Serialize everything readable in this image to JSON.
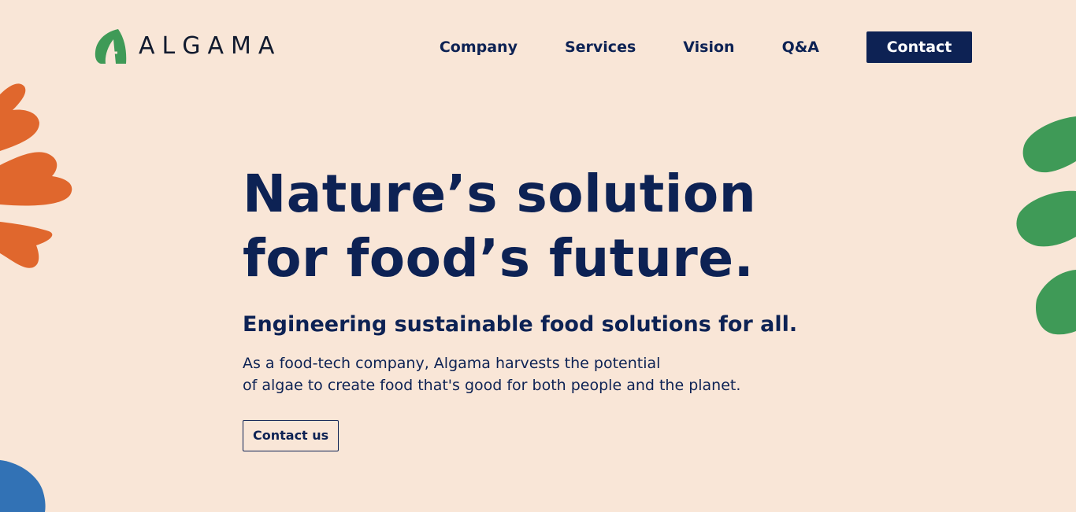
{
  "brand": {
    "name": "ALGAMA",
    "logo_icon": "algae-leaf-a-icon",
    "logo_color": "#3f9a57"
  },
  "nav": {
    "items": [
      {
        "label": "Company"
      },
      {
        "label": "Services"
      },
      {
        "label": "Vision"
      },
      {
        "label": "Q&A"
      }
    ],
    "contact_label": "Contact"
  },
  "hero": {
    "headline_line1": "Nature’s solution",
    "headline_line2": "for food’s future.",
    "subheadline": "Engineering sustainable food solutions for all.",
    "description_line1": "As a food-tech company, Algama harvests the potential",
    "description_line2": "of algae to create food that's good for both people and the planet.",
    "cta_label": "Contact us"
  },
  "colors": {
    "background": "#f9e6d7",
    "primary": "#0d2254",
    "orange_accent": "#e0672d",
    "green_accent": "#3f9a57",
    "blue_accent": "#3272b5"
  },
  "decorations": [
    "orange-leaf-decoration",
    "green-leaf-decoration",
    "blue-blob-decoration"
  ]
}
